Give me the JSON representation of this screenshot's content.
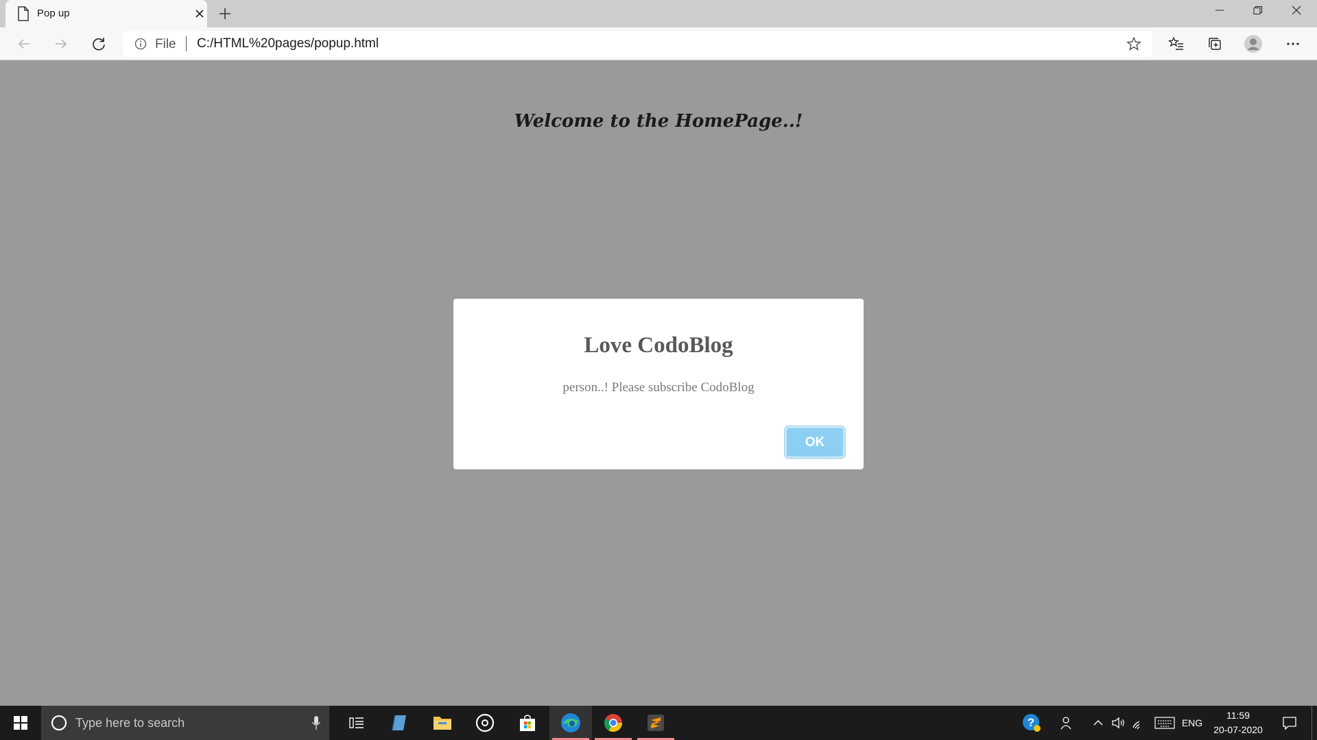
{
  "tab": {
    "title": "Pop up"
  },
  "address": {
    "scheme_label": "File",
    "url": "C:/HTML%20pages/popup.html"
  },
  "page": {
    "heading": "Welcome to the HomePage..!"
  },
  "modal": {
    "title": "Love CodoBlog",
    "message": "person..! Please subscribe CodoBlog",
    "ok_label": "OK"
  },
  "taskbar": {
    "search_placeholder": "Type here to search",
    "language": "ENG",
    "time": "11:59",
    "date": "20-07-2020",
    "apps": [
      "task-view",
      "notes",
      "file-explorer",
      "media",
      "store",
      "edge",
      "chrome",
      "sublime-text"
    ]
  },
  "colors": {
    "page_bg": "#9a9a9a",
    "ok_button": "#8ccff2",
    "taskbar": "#1b1b1b"
  }
}
